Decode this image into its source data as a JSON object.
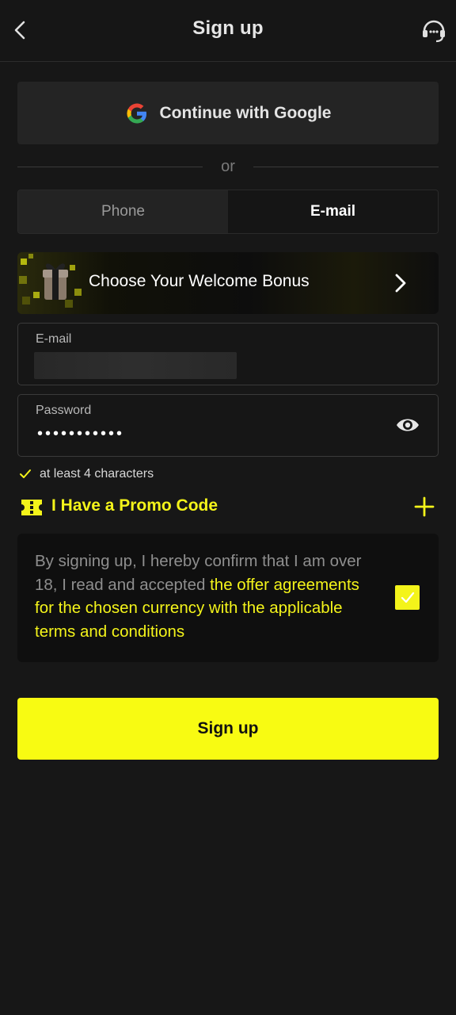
{
  "header": {
    "title": "Sign up",
    "back_icon": "chevron-left-icon",
    "support_icon": "headset-icon"
  },
  "google": {
    "label": "Continue with Google",
    "icon": "google-logo-icon"
  },
  "divider": {
    "or_text": "or"
  },
  "tabs": [
    {
      "label": "Phone",
      "active": false
    },
    {
      "label": "E-mail",
      "active": true
    }
  ],
  "bonus": {
    "label": "Choose Your Welcome Bonus",
    "icon": "gift-icon",
    "chevron": "chevron-right-icon"
  },
  "email_field": {
    "label": "E-mail",
    "value": ""
  },
  "password_field": {
    "label": "Password",
    "value": "•••••••••••",
    "toggle_icon": "eye-icon"
  },
  "hint": {
    "text": "at least 4 characters",
    "icon": "check-icon"
  },
  "promo": {
    "label": "I Have a Promo Code",
    "icon": "ticket-icon",
    "plus_icon": "plus-icon"
  },
  "terms": {
    "text_before": "By signing up, I hereby confirm that I am over 18, I read and accepted ",
    "link_text": "the offer agreements for the chosen currency with the applicable terms and conditions",
    "checked": true
  },
  "submit": {
    "label": "Sign up"
  },
  "colors": {
    "background": "#171717",
    "accent": "#f8fb12",
    "accent_text": "#f4f41a",
    "surface": "#242424"
  }
}
